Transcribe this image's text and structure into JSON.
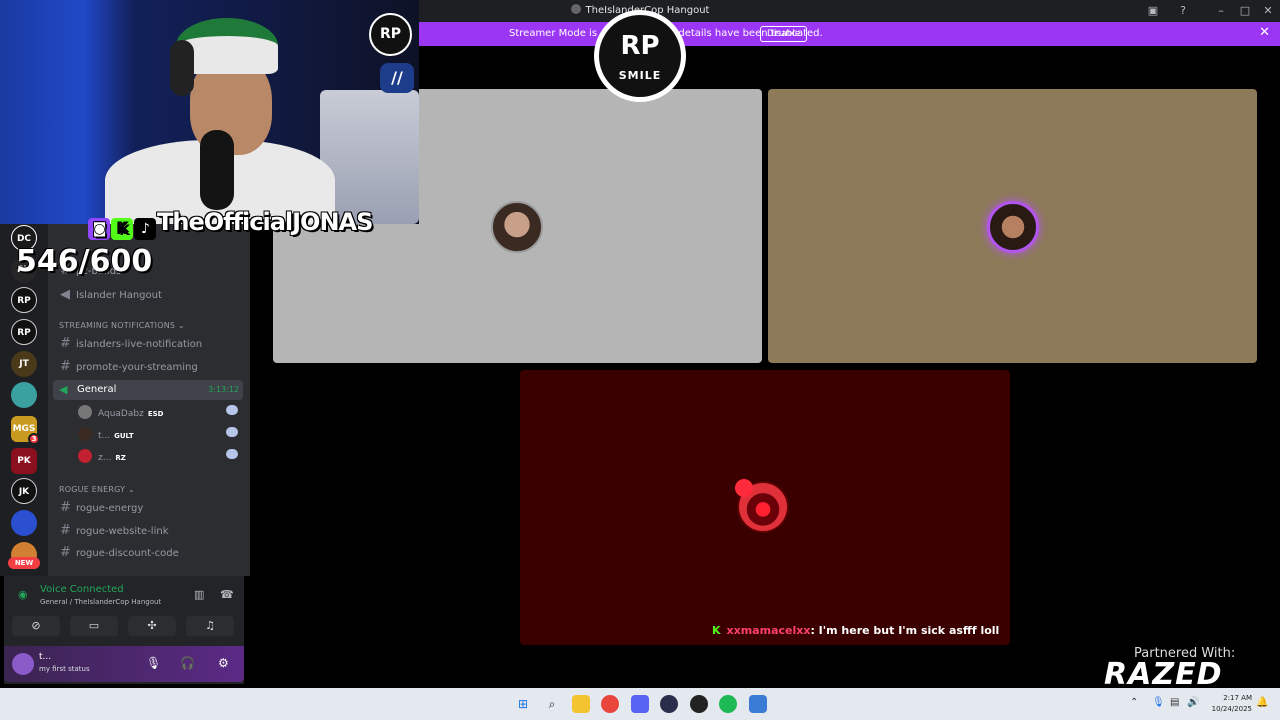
{
  "window": {
    "title": "TheIslanderCop Hangout"
  },
  "banner": {
    "text": "Streamer Mode is enabled. Some details have been truncated.",
    "disable_label": "Disable"
  },
  "overlay": {
    "handle": "TheOfficialJONAS",
    "counter": "546/600",
    "rp_logo": "RP",
    "rp_sub": "SMILE",
    "webcam_logo": "RP",
    "partner_label": "Partnered With:",
    "partner_brand": "RAZED"
  },
  "rail": {
    "servers": [
      "DC",
      "RV",
      "RP",
      "RP",
      "JT",
      "",
      "MGS",
      "PK",
      "JK",
      "",
      ""
    ],
    "ping_count": "3",
    "new_label": "NEW"
  },
  "sidebar": {
    "channels_top": [
      "pc-builds"
    ],
    "voice_hangout": "Islander Hangout",
    "category_streaming": "STREAMING NOTIFICATIONS",
    "streaming_channels": [
      "islanders-live-notification",
      "promote-your-streaming"
    ],
    "general": {
      "label": "General",
      "time": "3:13:12"
    },
    "voice_users": [
      {
        "name": "AquaDabz",
        "tag": "ESD"
      },
      {
        "name": "t...",
        "tag": "GULT"
      },
      {
        "name": "z...",
        "tag": "RZ"
      }
    ],
    "category_rogue": "ROGUE ENERGY",
    "rogue_channels": [
      "rogue-energy",
      "rogue-website-link",
      "rogue-discount-code"
    ]
  },
  "voice_panel": {
    "status": "Voice Connected",
    "location": "General / TheIslanderCop Hangout"
  },
  "user": {
    "name": "t...",
    "status": "my first status"
  },
  "chat_overlay": {
    "user": "xxmamacelxx",
    "message": ": I'm here but I'm sick asfff loll"
  },
  "taskbar": {
    "time": "2:17 AM",
    "date": "10/24/2025"
  },
  "colors": {
    "accent": "#9b36f5",
    "online": "#23a55a",
    "danger": "#f23f43"
  }
}
